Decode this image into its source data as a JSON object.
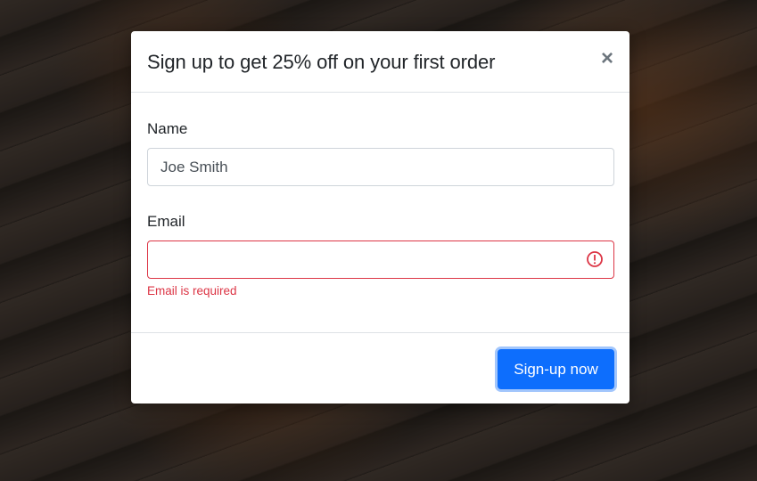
{
  "modal": {
    "title": "Sign up to get 25% off on your first order",
    "close_glyph": "×"
  },
  "form": {
    "name_label": "Name",
    "name_value": "Joe Smith",
    "email_label": "Email",
    "email_value": "",
    "email_error": "Email is required"
  },
  "footer": {
    "submit_label": "Sign-up now"
  },
  "colors": {
    "primary": "#0d6efd",
    "error": "#dc3545"
  },
  "icons": {
    "close": "close-icon",
    "error": "error-circle-icon"
  }
}
